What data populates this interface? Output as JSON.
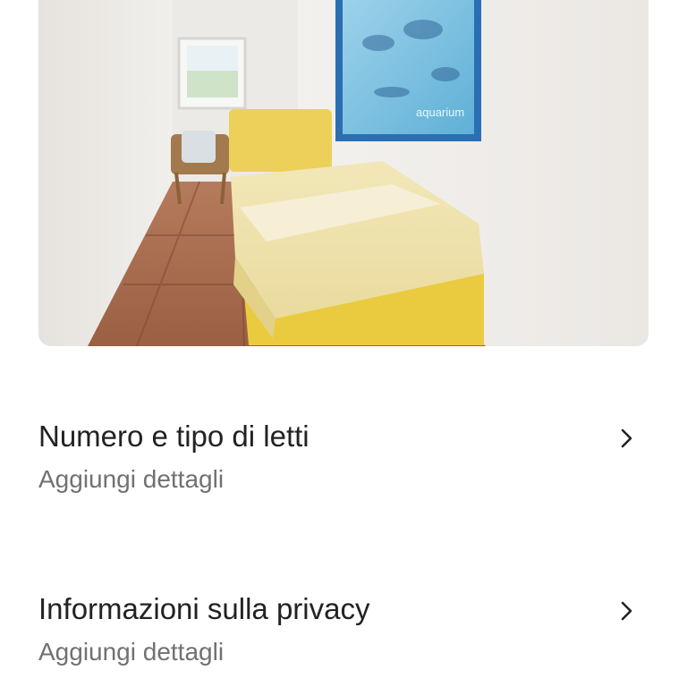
{
  "photo": {
    "description_icon": "room-photo",
    "poster_caption": "aquarium"
  },
  "rows": [
    {
      "title": "Numero e tipo di letti",
      "subtitle": "Aggiungi dettagli",
      "icon": "chevron-right-icon"
    },
    {
      "title": "Informazioni sulla privacy",
      "subtitle": "Aggiungi dettagli",
      "icon": "chevron-right-icon"
    }
  ],
  "colors": {
    "title": "#222222",
    "subtitle": "#717171",
    "background": "#ffffff"
  }
}
